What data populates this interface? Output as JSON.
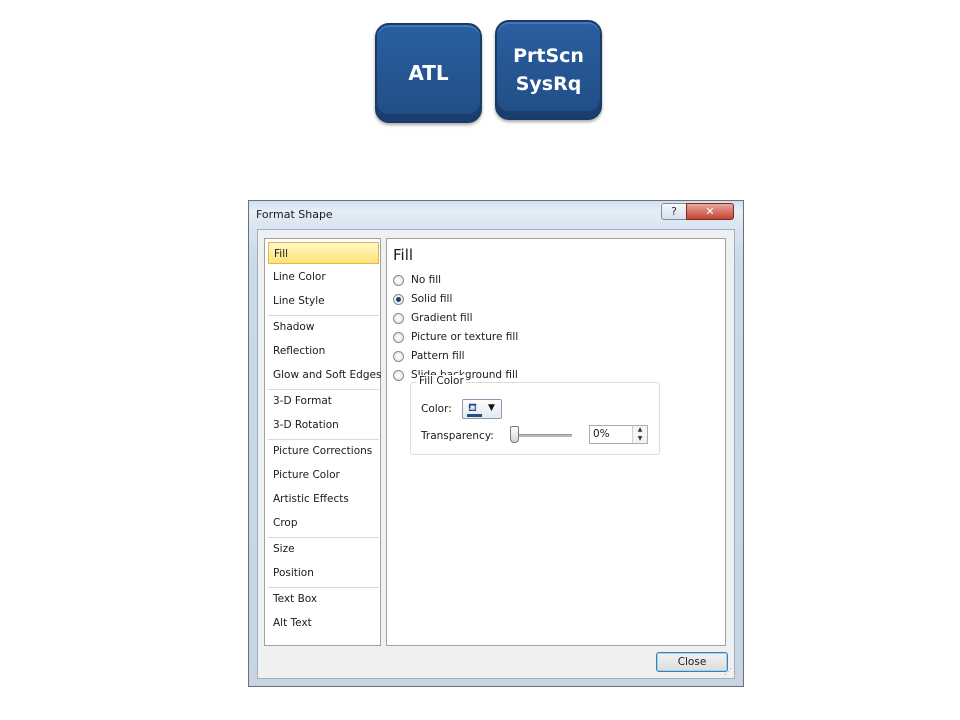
{
  "keys": {
    "alt": "ATL",
    "prtscn_line1": "PrtScn",
    "prtscn_line2": "SysRq"
  },
  "dialog": {
    "title": "Format Shape",
    "help_glyph": "?",
    "close_glyph": "✕",
    "nav_items": [
      "Fill",
      "Line Color",
      "Line Style",
      "Shadow",
      "Reflection",
      "Glow and Soft Edges",
      "3-D Format",
      "3-D Rotation",
      "Picture Corrections",
      "Picture Color",
      "Artistic Effects",
      "Crop",
      "Size",
      "Position",
      "Text Box",
      "Alt Text"
    ],
    "selected_nav": "Fill",
    "panel": {
      "heading": "Fill",
      "options": [
        "No fill",
        "Solid fill",
        "Gradient fill",
        "Picture or texture fill",
        "Pattern fill",
        "Slide background fill"
      ],
      "selected_option": "Solid fill",
      "group_label": "Fill Color",
      "color_label": "Color:",
      "transparency_label": "Transparency:",
      "transparency_value": "0%",
      "transparency_fraction": 0
    },
    "close_button": "Close"
  },
  "colors": {
    "key_blue": "#2a5fa0",
    "selected_nav_bg": "#ffe476",
    "fill_color_swatch": "#1f4f8f"
  },
  "icons": {
    "color": "paint-bucket-icon",
    "dropdown": "caret-down-icon"
  }
}
